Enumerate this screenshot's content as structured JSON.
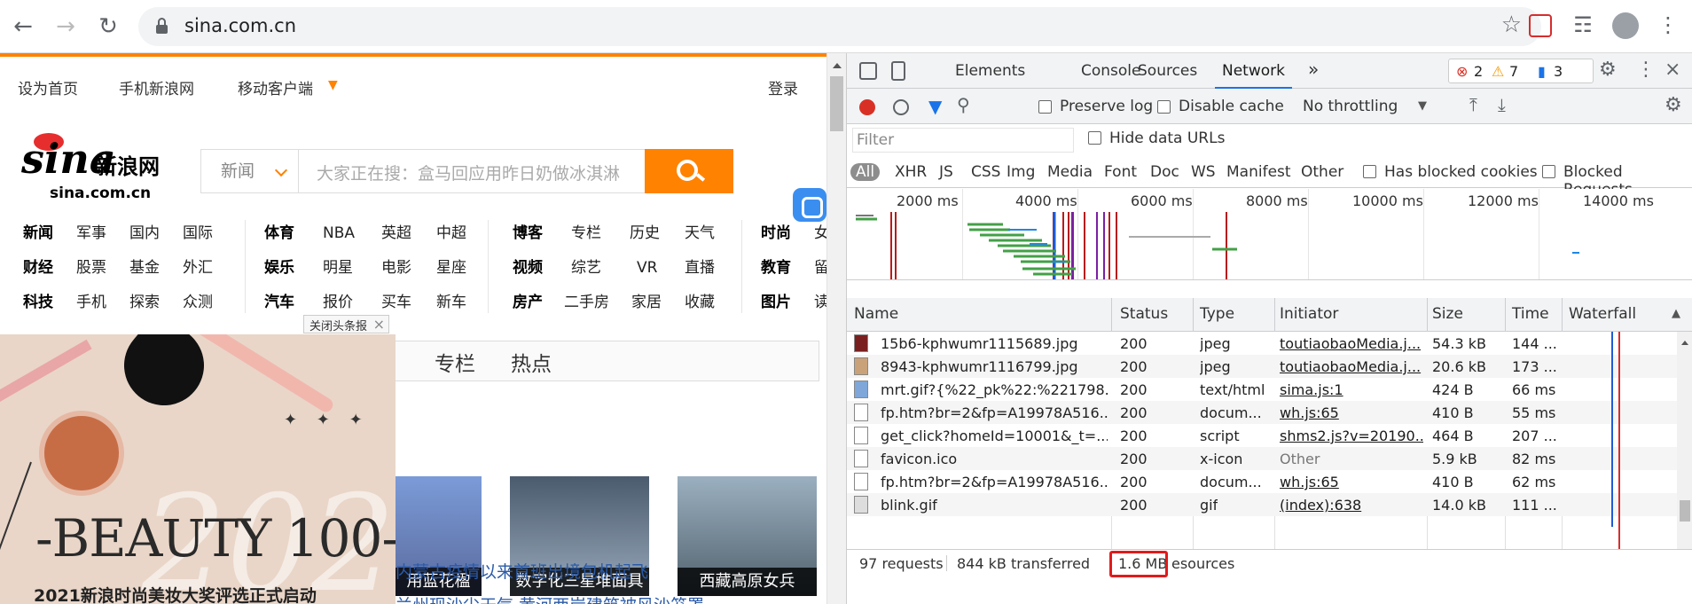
{
  "browser": {
    "url": "sina.com.cn"
  },
  "site": {
    "topnav": [
      "设为首页",
      "手机新浪网",
      "移动客户端"
    ],
    "login": "登录",
    "logo": {
      "mark": "sina",
      "cn": "新浪网",
      "domain": "sina.com.cn"
    },
    "search": {
      "category": "新闻",
      "placeholder": "大家正在搜：盒马回应用昨日奶做冰淇淋"
    },
    "categories": [
      {
        "header": [
          "新闻",
          "财经",
          "科技"
        ],
        "cols": [
          [
            "军事",
            "股票",
            "手机"
          ],
          [
            "国内",
            "基金",
            "探索"
          ],
          [
            "国际",
            "外汇",
            "众测"
          ]
        ]
      },
      {
        "header": [
          "体育",
          "娱乐",
          "汽车"
        ],
        "cols": [
          [
            "NBA",
            "明星",
            "报价"
          ],
          [
            "英超",
            "电影",
            "买车"
          ],
          [
            "中超",
            "星座",
            "新车"
          ]
        ]
      },
      {
        "header": [
          "博客",
          "视频",
          "房产"
        ],
        "cols": [
          [
            "专栏",
            "综艺",
            "二手房"
          ],
          [
            "历史",
            "VR",
            "家居"
          ],
          [
            "天气",
            "直播",
            "收藏"
          ]
        ]
      },
      {
        "header": [
          "时尚",
          "教育",
          "图片"
        ],
        "cols": [
          [
            "女",
            "留",
            "读"
          ]
        ]
      }
    ],
    "close_ad": "关闭头条报",
    "ad": {
      "title": "-BEAUTY 100-",
      "caption": "2021新浪时尚美妆大奖评选正式启动",
      "year": "2021",
      "stars": "✦ ✦ ✦"
    },
    "tabs": [
      "专栏",
      "热点"
    ],
    "thumbs": [
      "用蓝花楹",
      "数字化三星堆面具",
      "西藏高原女兵"
    ],
    "news": [
      "内蒙古疫情以来首班出境包机起飞",
      "兰州现沙尘天气 黄河两岸建筑被风沙笼罩"
    ]
  },
  "devtools": {
    "tabs": [
      "Elements",
      "Console",
      "Sources",
      "Network"
    ],
    "active_tab": "Network",
    "badges": {
      "errors": "2",
      "warnings": "7",
      "info": "3"
    },
    "toolbar": {
      "preserve_log": "Preserve log",
      "disable_cache": "Disable cache",
      "throttling": "No throttling"
    },
    "filter": {
      "placeholder": "Filter",
      "hide_data_urls": "Hide data URLs",
      "types": [
        "All",
        "XHR",
        "JS",
        "CSS",
        "Img",
        "Media",
        "Font",
        "Doc",
        "WS",
        "Manifest",
        "Other"
      ],
      "blocked_cookies": "Has blocked cookies",
      "blocked_requests": "Blocked Requests"
    },
    "overview_ticks": [
      "2000 ms",
      "4000 ms",
      "6000 ms",
      "8000 ms",
      "10000 ms",
      "12000 ms",
      "14000 ms"
    ],
    "columns": [
      "Name",
      "Status",
      "Type",
      "Initiator",
      "Size",
      "Time",
      "Waterfall"
    ],
    "rows": [
      {
        "name": "15b6-kphwumr1115689.jpg",
        "status": "200",
        "type": "jpeg",
        "initiator": "toutiaobaoMedia.j...",
        "size": "54.3 kB",
        "time": "144 ..."
      },
      {
        "name": "8943-kphwumr1116799.jpg",
        "status": "200",
        "type": "jpeg",
        "initiator": "toutiaobaoMedia.j...",
        "size": "20.6 kB",
        "time": "173 ..."
      },
      {
        "name": "mrt.gif?{%22_pk%22:%221798...",
        "status": "200",
        "type": "text/html",
        "initiator": "sima.js:1",
        "size": "424 B",
        "time": "66 ms"
      },
      {
        "name": "fp.htm?br=2&fp=A19978A516...",
        "status": "200",
        "type": "docum...",
        "initiator": "wh.js:65",
        "size": "410 B",
        "time": "55 ms"
      },
      {
        "name": "get_click?homeId=10001&_t=...",
        "status": "200",
        "type": "script",
        "initiator": "shms2.js?v=20190...",
        "size": "464 B",
        "time": "207 ..."
      },
      {
        "name": "favicon.ico",
        "status": "200",
        "type": "x-icon",
        "initiator": "Other",
        "size": "5.9 kB",
        "time": "82 ms"
      },
      {
        "name": "fp.htm?br=2&fp=A19978A516...",
        "status": "200",
        "type": "docum...",
        "initiator": "wh.js:65",
        "size": "410 B",
        "time": "62 ms"
      },
      {
        "name": "blink.gif",
        "status": "200",
        "type": "gif",
        "initiator": "(index):638",
        "size": "14.0 kB",
        "time": "111 ..."
      }
    ],
    "status": {
      "requests": "97 requests",
      "transferred": "844 kB transferred",
      "resources_value": "1.6 MB",
      "resources_suffix": "esources"
    }
  }
}
